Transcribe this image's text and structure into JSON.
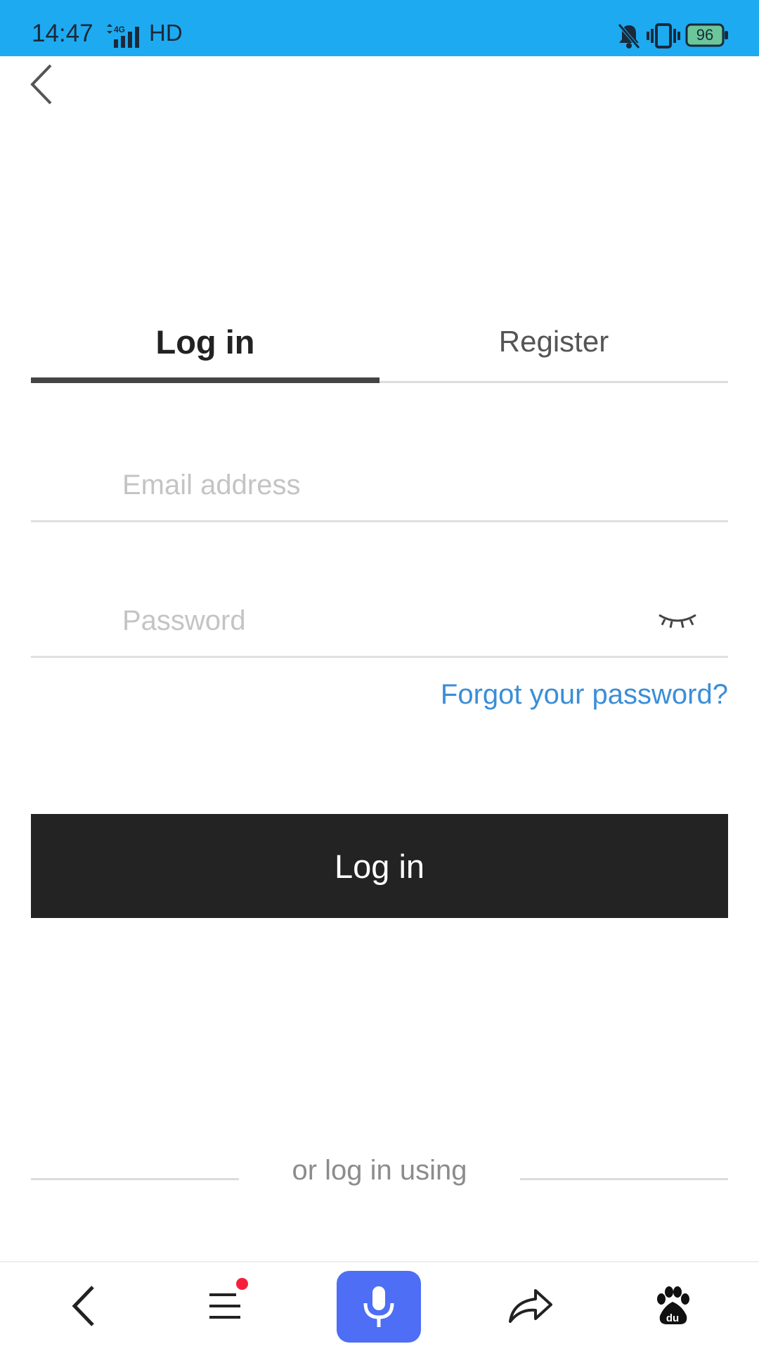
{
  "status_bar": {
    "time": "14:47",
    "network": "4G",
    "hd": "HD",
    "battery": "96",
    "icons": [
      "signal-icon",
      "bell-muted-icon",
      "vibrate-icon",
      "battery-icon"
    ]
  },
  "header": {
    "back_icon": "chevron-left-icon"
  },
  "tabs": [
    {
      "label": "Log in",
      "active": true
    },
    {
      "label": "Register",
      "active": false
    }
  ],
  "form": {
    "email": {
      "placeholder": "Email address",
      "value": ""
    },
    "password": {
      "placeholder": "Password",
      "value": "",
      "toggle_icon": "eye-closed-icon"
    },
    "forgot_label": "Forgot your password?",
    "submit_label": "Log in"
  },
  "social": {
    "divider_label": "or log in using"
  },
  "bottom_nav": {
    "items": [
      "back-icon",
      "menu-icon",
      "microphone-icon",
      "share-icon",
      "baidu-paw-icon"
    ],
    "menu_has_notification": true
  },
  "colors": {
    "status_bar": "#1eaaf1",
    "primary_button": "#232323",
    "link": "#3b8ed8",
    "voice_button": "#4d6ef5",
    "notification_dot": "#f5213b"
  }
}
